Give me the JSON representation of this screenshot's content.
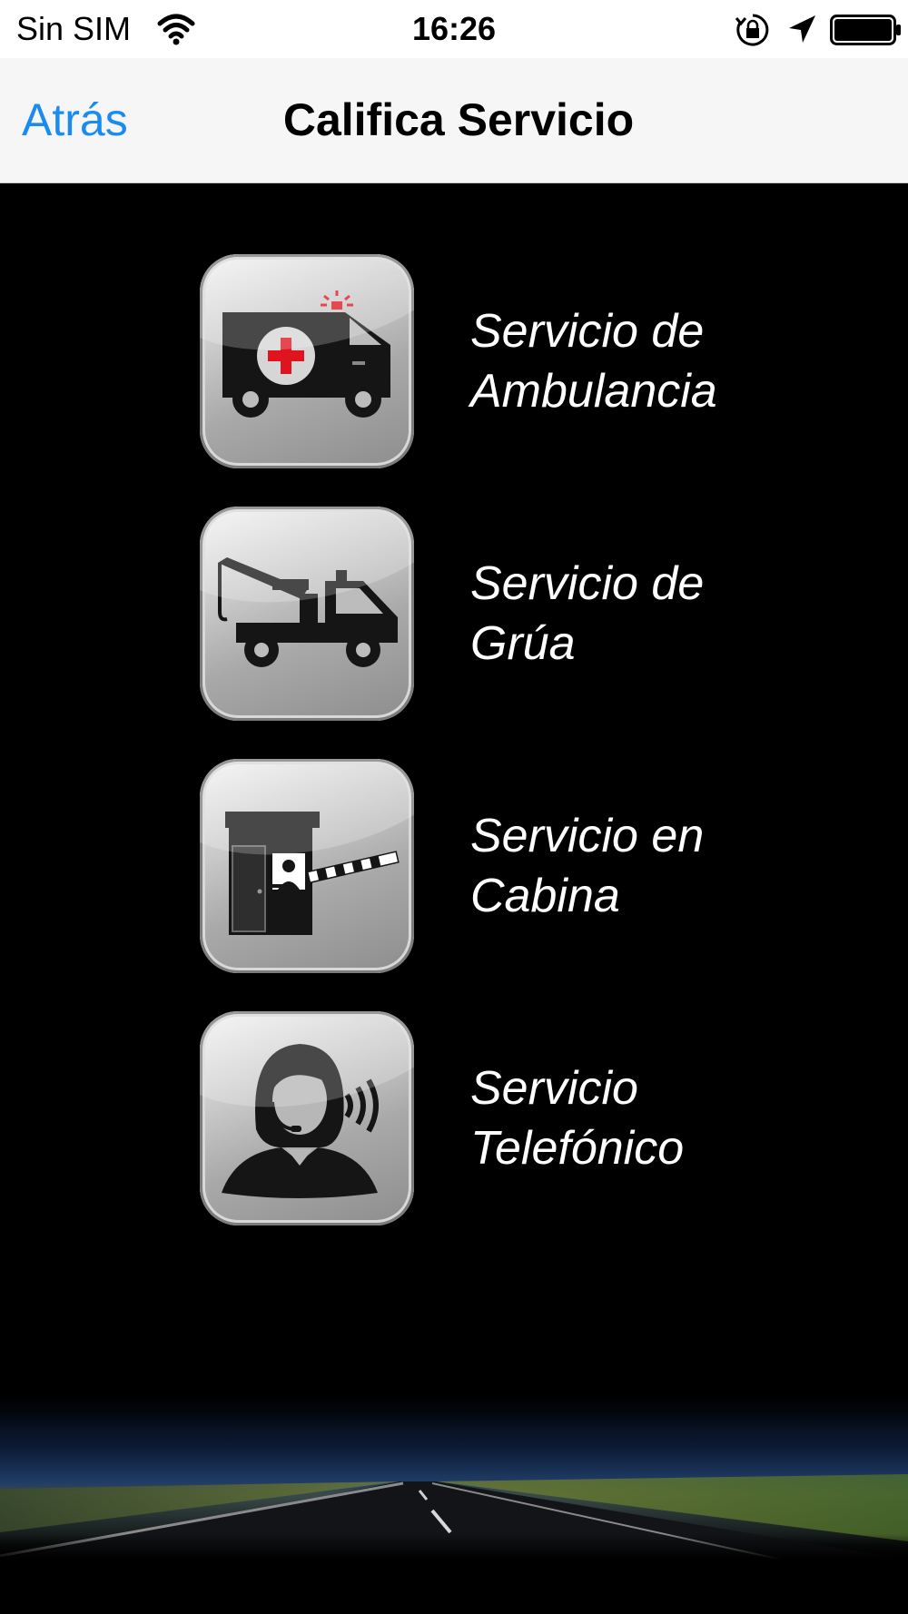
{
  "status_bar": {
    "carrier": "Sin SIM",
    "time": "16:26",
    "icons": [
      "wifi-icon",
      "rotation-lock-icon",
      "location-arrow-icon",
      "battery-icon"
    ]
  },
  "nav": {
    "back_label": "Atrás",
    "title": "Califica Servicio"
  },
  "services": [
    {
      "icon": "ambulance-icon",
      "line1": "Servicio de",
      "line2": "Ambulancia"
    },
    {
      "icon": "tow-truck-icon",
      "line1": "Servicio de",
      "line2": "Grúa"
    },
    {
      "icon": "toll-booth-icon",
      "line1": "Servicio en",
      "line2": "Cabina"
    },
    {
      "icon": "call-center-agent-icon",
      "line1": "Servicio",
      "line2": "Telefónico"
    }
  ],
  "colors": {
    "accent": "#1a8cf0",
    "nav_background": "#f6f6f7",
    "background": "#000000",
    "label_text": "#ffffff",
    "red_cross": "#e0141e"
  }
}
